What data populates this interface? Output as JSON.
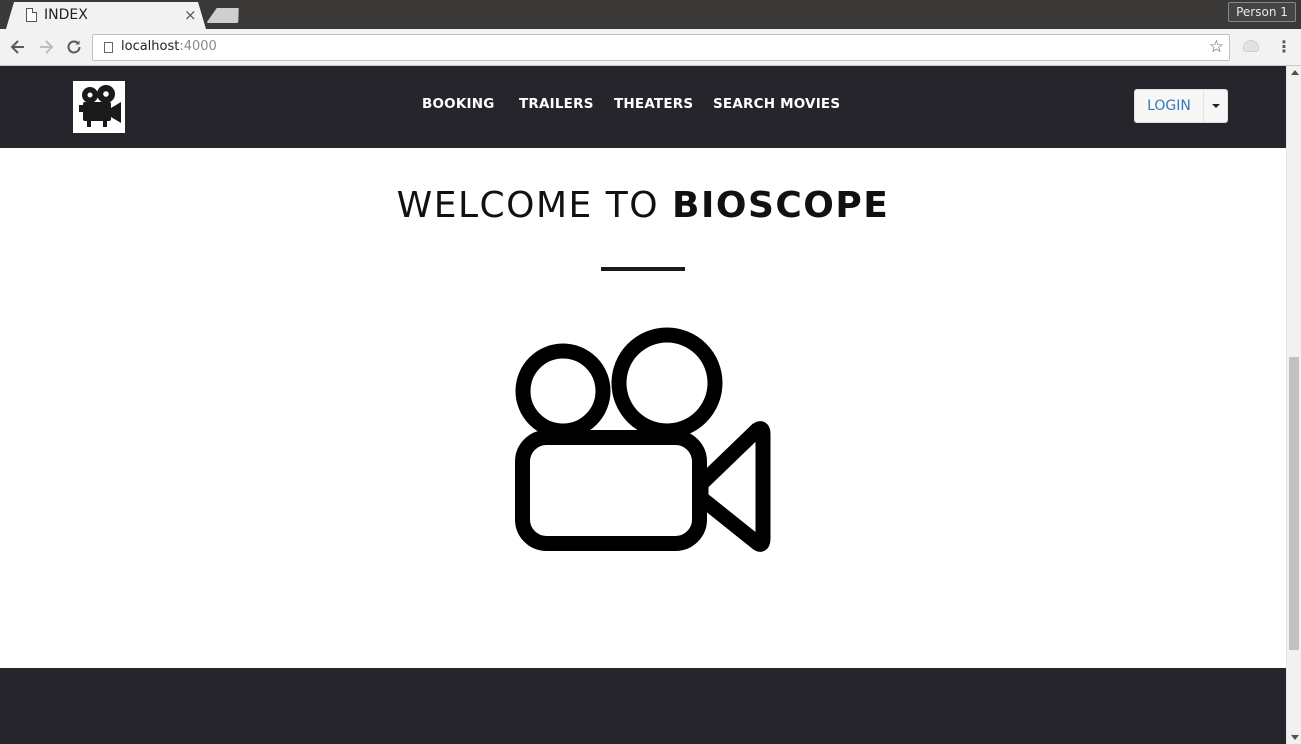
{
  "browser": {
    "tab_title": "INDEX",
    "tab_close": "×",
    "profile": "Person 1",
    "url_host": "localhost",
    "url_port": ":4000",
    "back_icon": "arrow-left-icon",
    "forward_icon": "arrow-right-icon",
    "reload_icon": "reload-icon",
    "bookmark_icon": "star-icon",
    "menu_icon": "kebab-menu-icon"
  },
  "site": {
    "logo_icon": "movie-camera-icon",
    "nav": {
      "booking": "BOOKING",
      "trailers": "TRAILERS",
      "theaters": "THEATERS",
      "search": "SEARCH MOVIES"
    },
    "login_label": "LOGIN",
    "welcome_light": "WELCOME TO ",
    "welcome_bold": "BIOSCOPE",
    "hero_icon": "movie-camera-icon"
  },
  "colors": {
    "nav_bg": "#26252b",
    "login_text": "#337ab7",
    "nav_text": "#ffffff"
  }
}
